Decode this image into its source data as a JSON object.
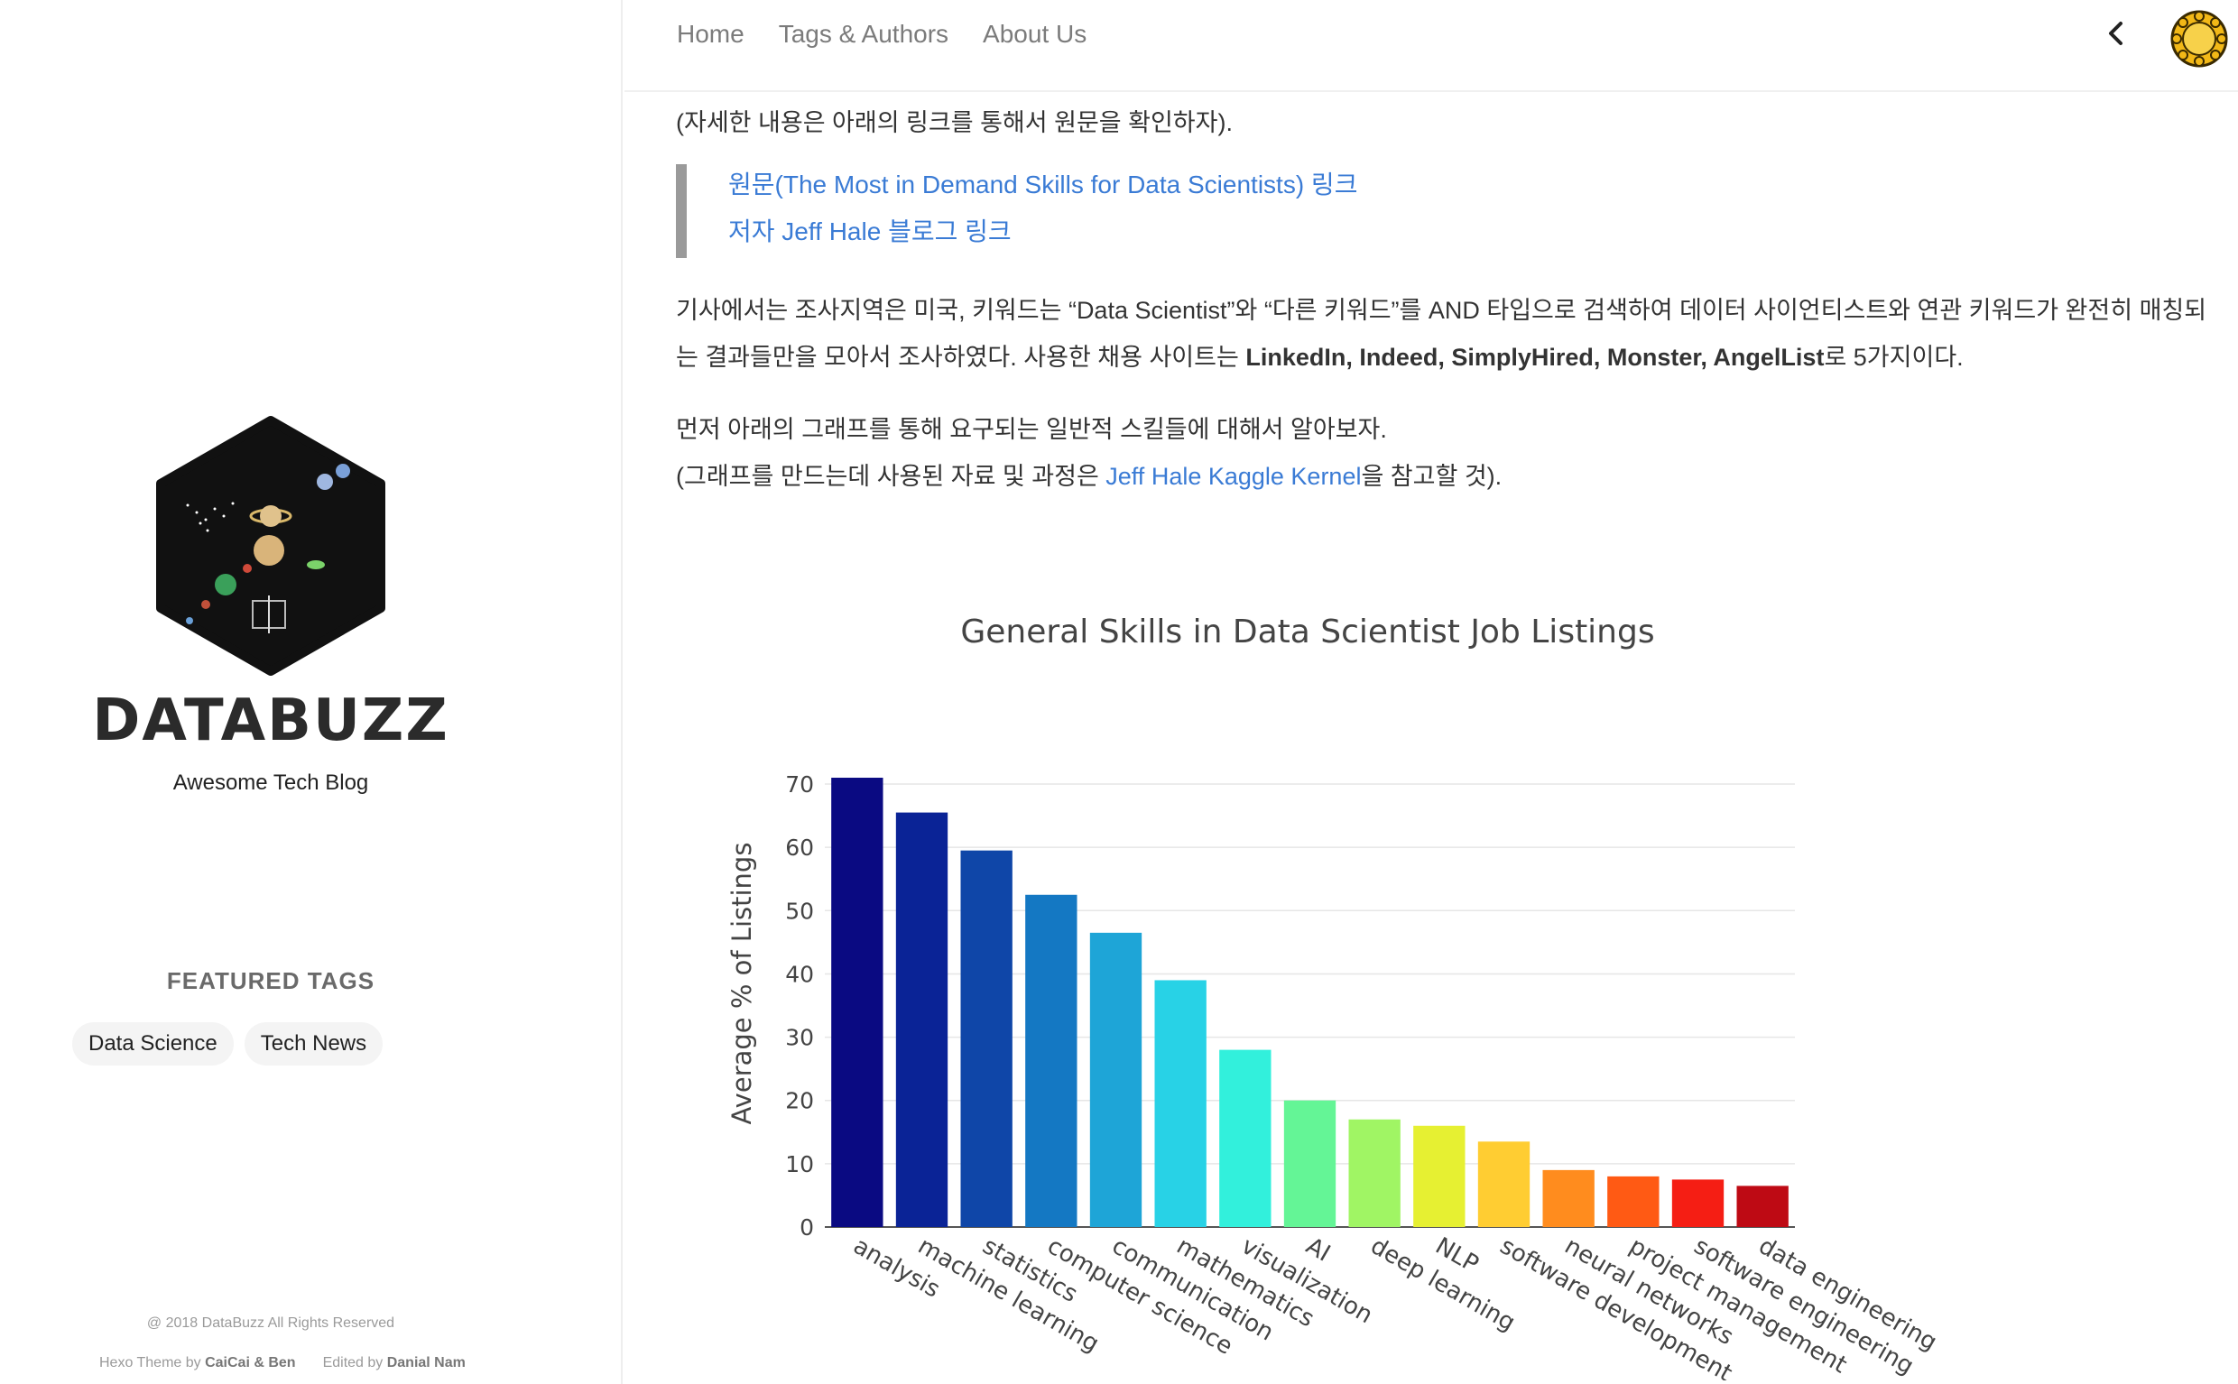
{
  "sidebar": {
    "title": "DATABUZZ",
    "subtitle": "Awesome Tech Blog",
    "featured_title": "FEATURED TAGS",
    "tags": [
      "Data Science",
      "Tech News"
    ],
    "copyright": "@ 2018 DataBuzz All Rights Reserved",
    "credits": {
      "theme_prefix": "Hexo Theme by ",
      "theme_authors": "CaiCai & Ben",
      "edited_prefix": "Edited by ",
      "editor": "Danial Nam"
    }
  },
  "nav": {
    "items": [
      "Home",
      "Tags & Authors",
      "About Us"
    ]
  },
  "content": {
    "intro": "(자세한 내용은 아래의 링크를 통해서 원문을 확인하자).",
    "quote_links": [
      "원문(The Most in Demand Skills for Data Scientists) 링크",
      "저자 Jeff Hale 블로그 링크"
    ],
    "para1_line1": "기사에서는 조사지역은 미국, 키워드는 “Data Scientist”와 “다른 키워드”를 AND 타입으로 검색하여 데이터 사이언티스트와 연관 키워드가 완전히 매칭되",
    "para1_line2_start": "는 결과들만을 모아서 조사하였다. 사용한 채용 사이트는 ",
    "para1_sites": "LinkedIn, Indeed, SimplyHired, Monster, AngelList",
    "para1_line2_end": "로 5가지이다.",
    "para2_line1": "먼저 아래의 그래프를 통해 요구되는 일반적 스킬들에 대해서 알아보자.",
    "para2_line2_start": "(그래프를 만드는데 사용된 자료 및 과정은 ",
    "para2_link": "Jeff Hale Kaggle Kernel",
    "para2_line2_end": "을 참고할 것)."
  },
  "chart_data": {
    "type": "bar",
    "title": "General Skills in Data Scientist Job Listings",
    "xlabel": "",
    "ylabel": "Average % of Listings",
    "ylim": [
      0,
      72
    ],
    "yticks": [
      0,
      10,
      20,
      30,
      40,
      50,
      60,
      70
    ],
    "grid": true,
    "categories": [
      "analysis",
      "machine learning",
      "statistics",
      "computer science",
      "communication",
      "mathematics",
      "visualization",
      "AI",
      "deep learning",
      "NLP",
      "software development",
      "neural networks",
      "project management",
      "software engineering",
      "data engineering"
    ],
    "values": [
      71,
      65.5,
      59.5,
      52.5,
      46.5,
      39,
      28,
      20,
      17,
      16,
      13.5,
      9,
      8,
      7.5,
      6.5
    ],
    "colors": [
      "#0a0a82",
      "#0a2396",
      "#0f46a8",
      "#1478c3",
      "#1ea5d7",
      "#28d2e6",
      "#32f0dc",
      "#64f596",
      "#a0f564",
      "#e6f032",
      "#ffcd32",
      "#ff8c1e",
      "#ff5a14",
      "#f51e14",
      "#be0a14"
    ]
  }
}
